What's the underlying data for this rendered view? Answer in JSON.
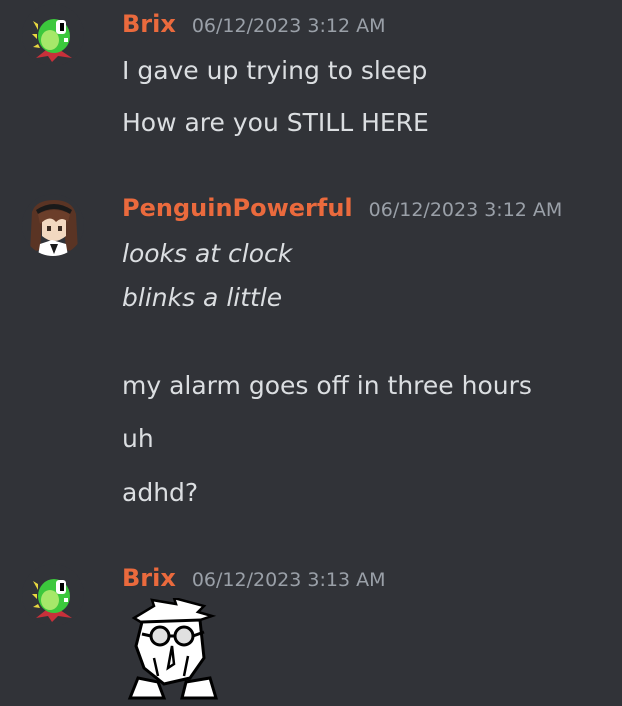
{
  "messages": [
    {
      "author": "Brix",
      "timestamp": "06/12/2023 3:12 AM",
      "avatar_icon": "green-dinosaur-avatar",
      "lines": [
        "I gave up trying to sleep",
        "How are you STILL HERE"
      ]
    },
    {
      "author": "PenguinPowerful",
      "timestamp": "06/12/2023 3:12 AM",
      "avatar_icon": "brown-hair-character-avatar",
      "lines": [
        "looks at clock",
        "blinks a little",
        "my alarm goes off in three hours",
        "uh",
        "adhd?"
      ]
    },
    {
      "author": "Brix",
      "timestamp": "06/12/2023 3:13 AM",
      "avatar_icon": "green-dinosaur-avatar",
      "attachment_icon": "goggles-character-sticker"
    }
  ],
  "colors": {
    "background": "#313338",
    "username": "#ea6a3d",
    "timestamp": "#9aa0a8",
    "text": "#dbdee1"
  }
}
